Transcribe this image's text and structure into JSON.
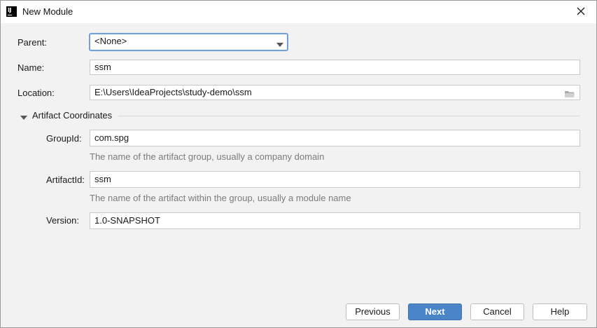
{
  "window": {
    "title": "New Module",
    "app_icon_text": "IJ"
  },
  "form": {
    "parent": {
      "label": "Parent:",
      "value": "<None>"
    },
    "name": {
      "label": "Name:",
      "value": "ssm"
    },
    "location": {
      "label": "Location:",
      "value": "E:\\Users\\IdeaProjects\\study-demo\\ssm"
    }
  },
  "artifact": {
    "section_title": "Artifact Coordinates",
    "group_id": {
      "label": "GroupId:",
      "value": "com.spg",
      "hint": "The name of the artifact group, usually a company domain"
    },
    "artifact_id": {
      "label": "ArtifactId:",
      "value": "ssm",
      "hint": "The name of the artifact within the group, usually a module name"
    },
    "version": {
      "label": "Version:",
      "value": "1.0-SNAPSHOT"
    }
  },
  "buttons": {
    "previous": "Previous",
    "next": "Next",
    "cancel": "Cancel",
    "help": "Help"
  },
  "colors": {
    "primary": "#4a86c7",
    "focus_border": "#6f9fdc",
    "hint_text": "#7b7b7b"
  }
}
